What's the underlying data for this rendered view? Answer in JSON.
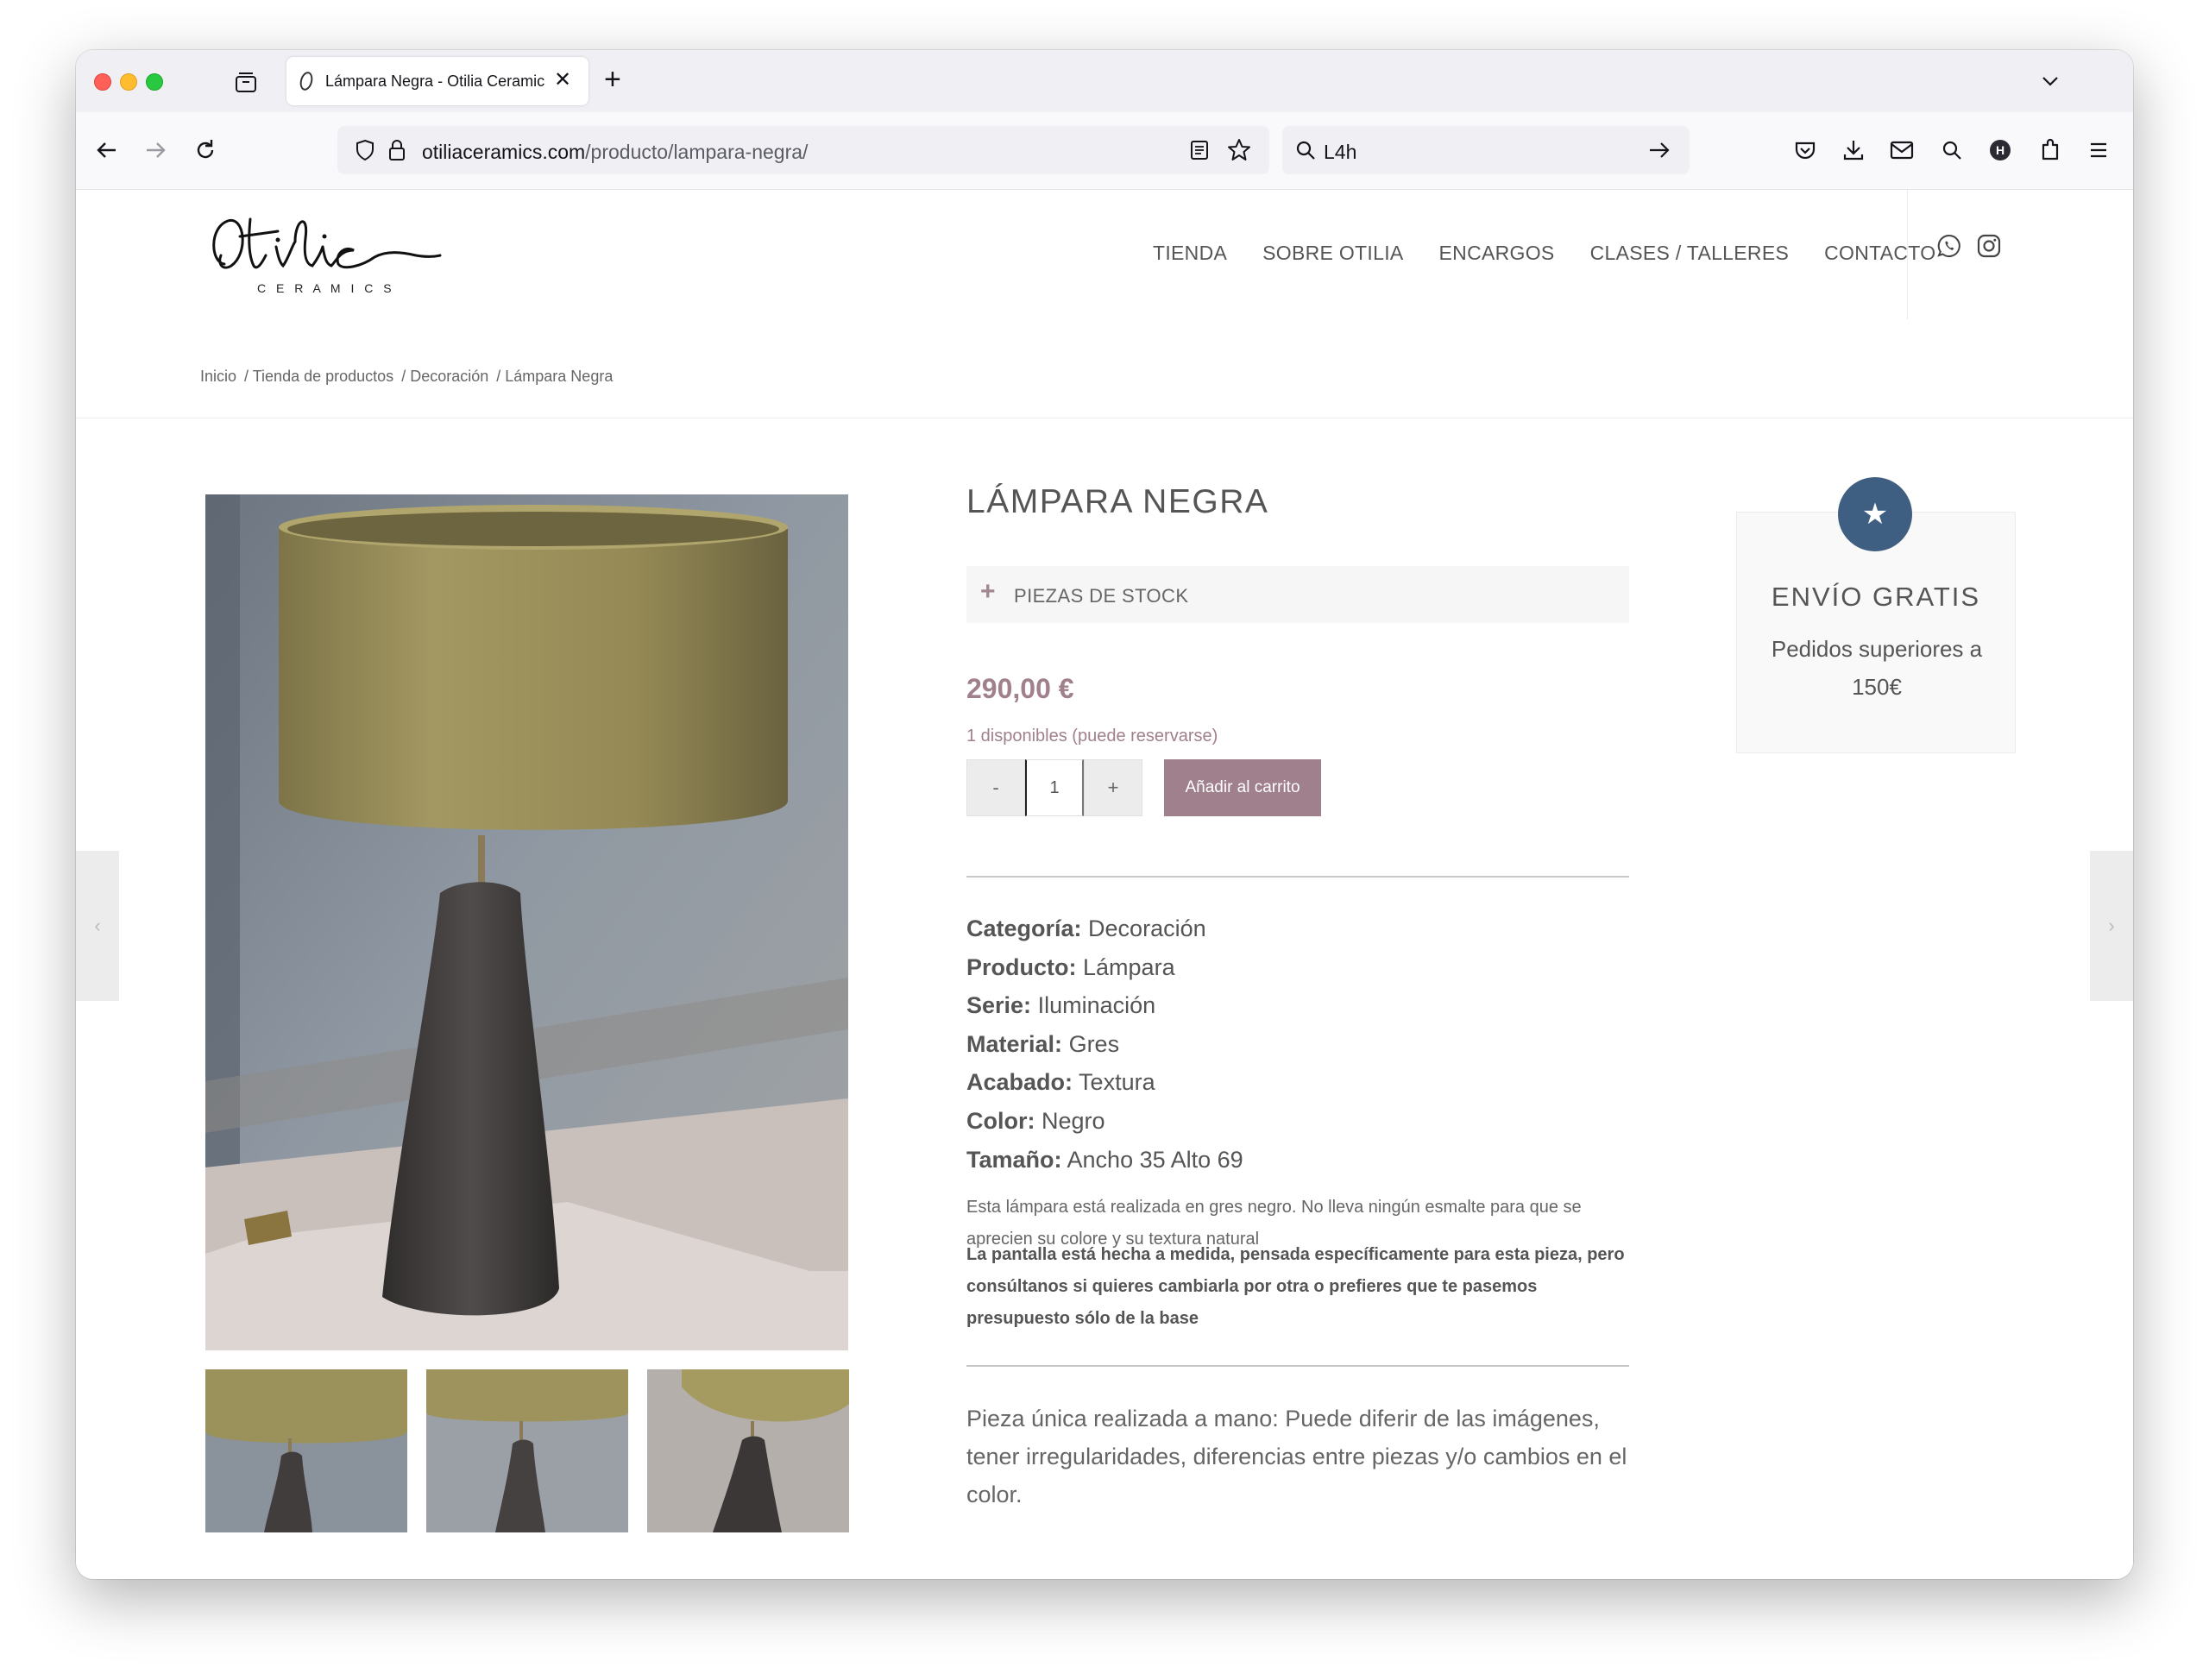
{
  "browser": {
    "tab_title": "Lámpara Negra - Otilia Ceramics",
    "url_domain": "otiliaceramics.com",
    "url_path": "/producto/lampara-negra/",
    "search_value": "L4h"
  },
  "site": {
    "logo_text": "Otilia",
    "logo_subtext": "C E R A M I C S",
    "nav": [
      "TIENDA",
      "SOBRE OTILIA",
      "ENCARGOS",
      "CLASES / TALLERES",
      "CONTACTO"
    ],
    "breadcrumb": [
      "Inicio",
      "/ Tienda de productos",
      "/ Decoración",
      "/ Lámpara Negra"
    ]
  },
  "product": {
    "title": "LÁMPARA NEGRA",
    "stock_label": "PIEZAS DE STOCK",
    "price": "290,00 €",
    "availability": "1 disponibles (puede reservarse)",
    "quantity": "1",
    "qty_minus": "-",
    "qty_plus": "+",
    "add_to_cart": "Añadir al carrito",
    "specs": [
      {
        "label": "Categoría:",
        "value": "Decoración"
      },
      {
        "label": "Producto:",
        "value": "Lámpara"
      },
      {
        "label": "Serie:",
        "value": "Iluminación"
      },
      {
        "label": "Material:",
        "value": "Gres"
      },
      {
        "label": "Acabado:",
        "value": "Textura"
      },
      {
        "label": "Color:",
        "value": "Negro"
      },
      {
        "label": "Tamaño:",
        "value": "Ancho 35 Alto 69"
      }
    ],
    "description": "Esta lámpara está realizada en gres negro. No lleva ningún esmalte para que se aprecien su colore y su textura natural",
    "description_bold": "La pantalla está hecha a medida, pensada específicamente para esta pieza, pero consúltanos si quieres cambiarla por otra o prefieres que te pasemos presupuesto sólo de la base",
    "handmade_note": "Pieza única realizada a mano: Puede diferir de las imágenes, tener irregularidades, diferencias entre piezas y/o cambios en el color."
  },
  "shipping": {
    "title": "ENVÍO GRATIS",
    "text": "Pedidos superiores a 150€",
    "badge_icon": "star-icon"
  },
  "colors": {
    "accent": "#a0808c",
    "badge": "#3f5f82"
  }
}
